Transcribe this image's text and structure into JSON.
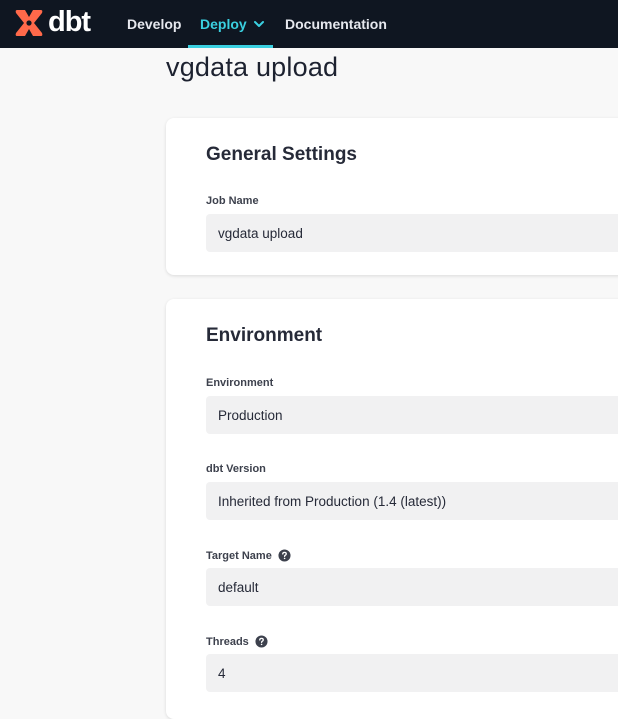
{
  "brand": {
    "name": "dbt",
    "accent": "#ff694a"
  },
  "nav": {
    "items": [
      {
        "label": "Develop"
      },
      {
        "label": "Deploy"
      },
      {
        "label": "Documentation"
      }
    ],
    "active": "Deploy",
    "active_color": "#3ad0e0"
  },
  "page": {
    "title": "vgdata upload"
  },
  "general_settings": {
    "title": "General Settings",
    "job_name": {
      "label": "Job Name",
      "value": "vgdata upload"
    }
  },
  "environment_section": {
    "title": "Environment",
    "environment": {
      "label": "Environment",
      "value": "Production"
    },
    "dbt_version": {
      "label": "dbt Version",
      "value": "Inherited from Production (1.4 (latest))"
    },
    "target_name": {
      "label": "Target Name",
      "value": "default",
      "icon": "help-circle-icon"
    },
    "threads": {
      "label": "Threads",
      "value": "4",
      "icon": "help-circle-icon"
    }
  }
}
